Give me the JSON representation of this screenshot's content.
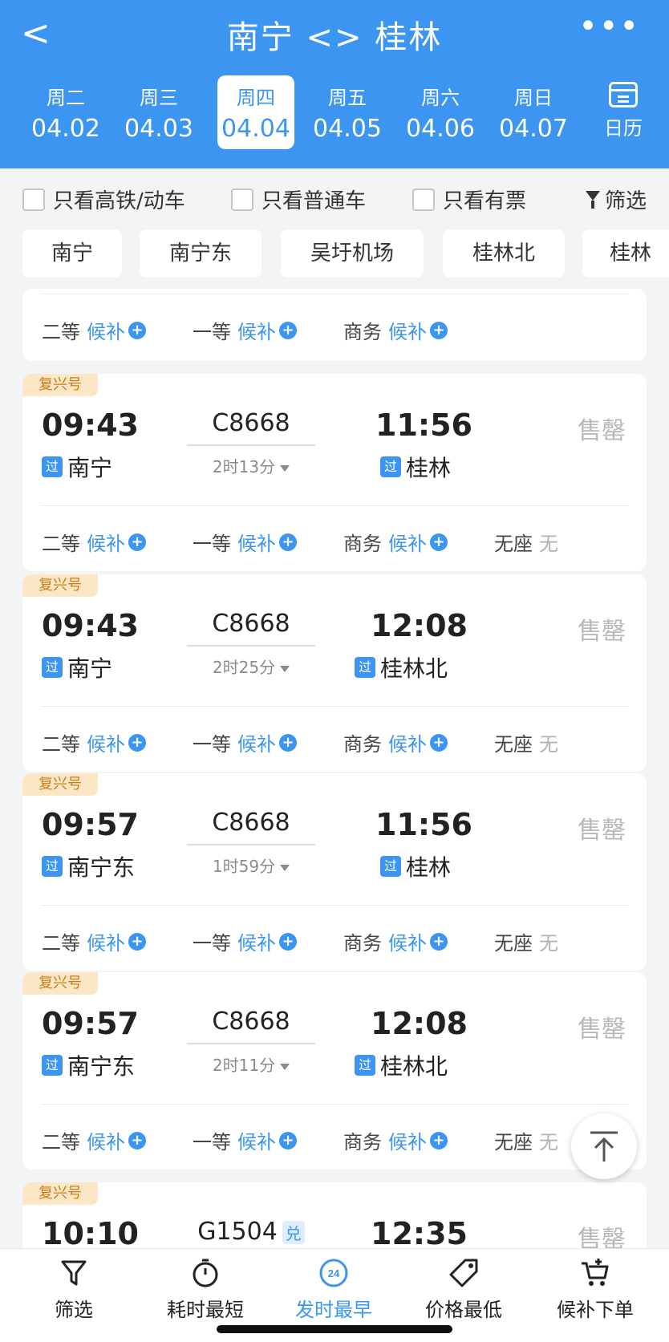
{
  "header": {
    "back": "<",
    "title": "南宁 <> 桂林",
    "more": "•••",
    "dates": [
      {
        "weekday": "周二",
        "date": "04.02"
      },
      {
        "weekday": "周三",
        "date": "04.03"
      },
      {
        "weekday": "周四",
        "date": "04.04",
        "active": true
      },
      {
        "weekday": "周五",
        "date": "04.05"
      },
      {
        "weekday": "周六",
        "date": "04.06"
      },
      {
        "weekday": "周日",
        "date": "04.07"
      }
    ],
    "calendar_label": "日历"
  },
  "filters": {
    "high_speed_only": "只看高铁/动车",
    "normal_only": "只看普通车",
    "available_only": "只看有票",
    "filter": "筛选"
  },
  "stations": [
    "南宁",
    "南宁东",
    "吴圩机场",
    "桂林北",
    "桂林"
  ],
  "partial_card": {
    "seats": [
      {
        "name": "二等",
        "status": "候补"
      },
      {
        "name": "一等",
        "status": "候补"
      },
      {
        "name": "商务",
        "status": "候补"
      }
    ]
  },
  "trains": [
    {
      "tag": "复兴号",
      "dep_time": "09:43",
      "train_no": "C8668",
      "arr_time": "11:56",
      "duration": "2时13分",
      "dep_station": "南宁",
      "arr_station": "桂林",
      "pass_label": "过",
      "sold": "售罄",
      "seats": [
        {
          "name": "二等",
          "status": "候补"
        },
        {
          "name": "一等",
          "status": "候补"
        },
        {
          "name": "商务",
          "status": "候补"
        },
        {
          "name": "无座",
          "status": "无"
        }
      ]
    },
    {
      "tag": "复兴号",
      "dep_time": "09:43",
      "train_no": "C8668",
      "arr_time": "12:08",
      "duration": "2时25分",
      "dep_station": "南宁",
      "arr_station": "桂林北",
      "pass_label": "过",
      "sold": "售罄",
      "seats": [
        {
          "name": "二等",
          "status": "候补"
        },
        {
          "name": "一等",
          "status": "候补"
        },
        {
          "name": "商务",
          "status": "候补"
        },
        {
          "name": "无座",
          "status": "无"
        }
      ]
    },
    {
      "tag": "复兴号",
      "dep_time": "09:57",
      "train_no": "C8668",
      "arr_time": "11:56",
      "duration": "1时59分",
      "dep_station": "南宁东",
      "arr_station": "桂林",
      "pass_label": "过",
      "sold": "售罄",
      "seats": [
        {
          "name": "二等",
          "status": "候补"
        },
        {
          "name": "一等",
          "status": "候补"
        },
        {
          "name": "商务",
          "status": "候补"
        },
        {
          "name": "无座",
          "status": "无"
        }
      ]
    },
    {
      "tag": "复兴号",
      "dep_time": "09:57",
      "train_no": "C8668",
      "arr_time": "12:08",
      "duration": "2时11分",
      "dep_station": "南宁东",
      "arr_station": "桂林北",
      "pass_label": "过",
      "sold": "售罄",
      "seats": [
        {
          "name": "二等",
          "status": "候补"
        },
        {
          "name": "一等",
          "status": "候补"
        },
        {
          "name": "商务",
          "status": "候补"
        },
        {
          "name": "无座",
          "status": "无"
        }
      ]
    },
    {
      "tag": "复兴号",
      "dep_time": "10:10",
      "train_no": "G1504",
      "train_badge": "兑",
      "arr_time": "12:35",
      "sold": "售罄"
    }
  ],
  "bottom_nav": [
    {
      "label": "筛选",
      "icon": "funnel-icon"
    },
    {
      "label": "耗时最短",
      "icon": "stopwatch-icon"
    },
    {
      "label": "发时最早",
      "icon": "clock-24-icon",
      "active": true,
      "icon_text": "24"
    },
    {
      "label": "价格最低",
      "icon": "price-tag-icon"
    },
    {
      "label": "候补下单",
      "icon": "cart-plus-icon"
    }
  ],
  "colors": {
    "primary": "#3c95f0",
    "tag_bg": "#fbe7c5",
    "tag_text": "#c77d1a",
    "sold_text": "#b8b8b8"
  }
}
